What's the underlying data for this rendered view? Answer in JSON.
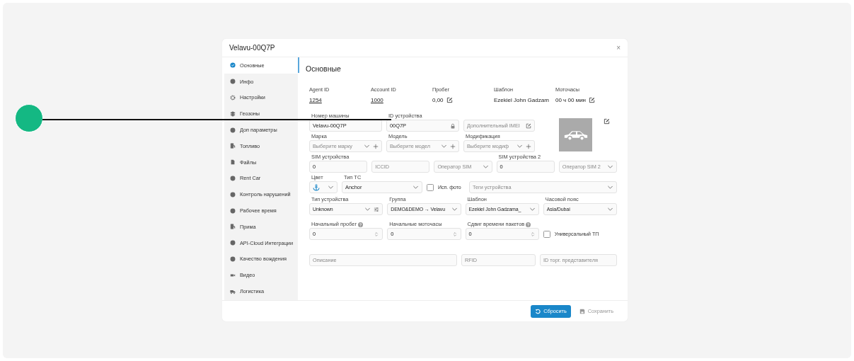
{
  "window": {
    "title": "Velavu-00Q7P",
    "close": "×"
  },
  "sidebar": {
    "items": [
      {
        "label": "Основные",
        "selected": true
      },
      {
        "label": "Инфо",
        "selected": false
      },
      {
        "label": "Настройки",
        "selected": false
      },
      {
        "label": "Геозоны",
        "selected": false
      },
      {
        "label": "Доп параметры",
        "selected": false
      },
      {
        "label": "Топливо",
        "selected": false
      },
      {
        "label": "Файлы",
        "selected": false
      },
      {
        "label": "Rent Car",
        "selected": false
      },
      {
        "label": "Контроль нарушений",
        "selected": false
      },
      {
        "label": "Рабочее время",
        "selected": false
      },
      {
        "label": "Прима",
        "selected": false
      },
      {
        "label": "API-Cloud Интеграции",
        "selected": false
      },
      {
        "label": "Качество вождения",
        "selected": false
      },
      {
        "label": "Видео",
        "selected": false
      },
      {
        "label": "Логистика",
        "selected": false
      }
    ]
  },
  "section_title": "Основные",
  "summary": [
    {
      "label": "Agent ID",
      "value": "1254",
      "kind": "link"
    },
    {
      "label": "Account ID",
      "value": "1000",
      "kind": "link"
    },
    {
      "label": "Пробег",
      "value": "0,00",
      "kind": "editable"
    },
    {
      "label": "Шаблон",
      "value": "Ezekiel John Gadzam",
      "kind": "text"
    },
    {
      "label": "Моточасы",
      "value": "00 ч 00 мин",
      "kind": "editable"
    }
  ],
  "rows": [
    [
      {
        "label": "Номер машины",
        "value": "Velavu-00Q7P",
        "kind": "text"
      },
      {
        "label": "ID устройства",
        "value": "00Q7P",
        "kind": "locked"
      },
      {
        "placeholder": "Дополнительный IMEI",
        "kind": "edit"
      }
    ],
    [
      {
        "label": "Марка",
        "placeholder": "Выберите марку",
        "kind": "select_add"
      },
      {
        "label": "Модель",
        "placeholder": "Выберите модел",
        "kind": "select_add"
      },
      {
        "label": "Модификация",
        "placeholder": "Выберите модиф",
        "kind": "select_add"
      }
    ],
    [
      {
        "label": "SIM устройства",
        "value": "0",
        "kind": "text"
      },
      {
        "placeholder": "ICCID",
        "kind": "text"
      },
      {
        "placeholder": "Оператор SIM",
        "kind": "select"
      },
      {
        "label": "SIM устройства 2",
        "value": "0",
        "kind": "text"
      },
      {
        "placeholder": "Оператор SIM 2",
        "kind": "select"
      }
    ],
    [
      {
        "label": "Цвет",
        "kind": "color"
      },
      {
        "label": "Тип ТС",
        "value": "Anchor",
        "kind": "select"
      },
      {
        "label": "Исп. фото",
        "kind": "checkbox",
        "checked": false
      },
      {
        "placeholder": "Теги устройства",
        "kind": "select"
      }
    ],
    [
      {
        "label": "Тип устройства",
        "value": "Unknown",
        "kind": "select_settings"
      },
      {
        "label": "Группа",
        "value": "DEMO&DEMO → Velavu",
        "kind": "select"
      },
      {
        "label": "Шаблон",
        "value": "Ezekiel John Gadzama_",
        "kind": "select"
      },
      {
        "label": "Часовой пояс",
        "value": "Asia/Dubai",
        "kind": "select"
      }
    ],
    [
      {
        "label": "Начальный пробег",
        "value": "0",
        "kind": "number",
        "help": true
      },
      {
        "label": "Начальные моточасы",
        "value": "0",
        "kind": "number",
        "help": false
      },
      {
        "label": "Сдвиг времени пакетов",
        "value": "0",
        "kind": "number",
        "help": true
      },
      {
        "label": "Универсальный ТП",
        "kind": "checkbox",
        "checked": false
      }
    ],
    [
      {
        "placeholder": "Описание",
        "kind": "text"
      },
      {
        "placeholder": "RFID",
        "kind": "text"
      },
      {
        "placeholder": "ID торг. представителя",
        "kind": "text"
      }
    ]
  ],
  "buttons": [
    {
      "label": "Сбросить",
      "kind": "reset",
      "disabled": false
    },
    {
      "label": "Сохранить",
      "kind": "save",
      "disabled": true
    }
  ]
}
